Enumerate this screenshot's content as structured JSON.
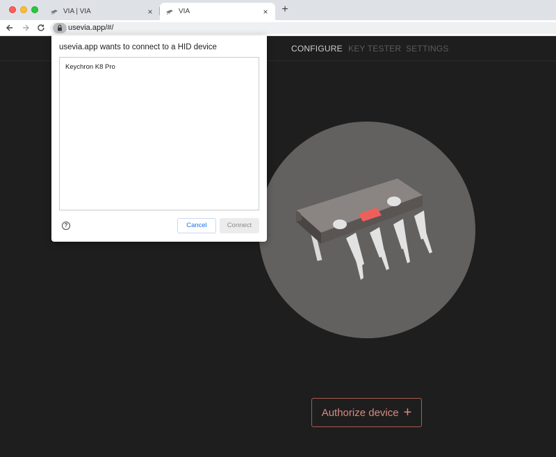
{
  "browser": {
    "tabs": [
      {
        "title": "VIA | VIA",
        "icon": "via-chip-icon",
        "active": false
      },
      {
        "title": "VIA",
        "icon": "via-chip-icon",
        "active": true
      }
    ],
    "tab_close_glyph": "×",
    "new_tab_glyph": "+",
    "url": "usevia.app/#/",
    "nav_icons": {
      "back": "arrow-back-icon",
      "forward": "arrow-forward-icon",
      "reload": "reload-icon",
      "lock": "lock-icon"
    }
  },
  "app": {
    "nav": {
      "configure": "CONFIGURE",
      "key_tester": "KEY TESTER",
      "settings": "SETTINGS"
    },
    "authorize_label": "Authorize device",
    "authorize_plus": "+",
    "colors": {
      "background": "#1e1e1e",
      "accent": "#d98a80",
      "chip_circle": "#636160",
      "chip_red": "#ef5f5a"
    }
  },
  "dialog": {
    "title": "usevia.app wants to connect to a HID device",
    "devices": [
      "Keychron K8 Pro"
    ],
    "help_glyph": "?",
    "cancel_label": "Cancel",
    "connect_label": "Connect"
  }
}
